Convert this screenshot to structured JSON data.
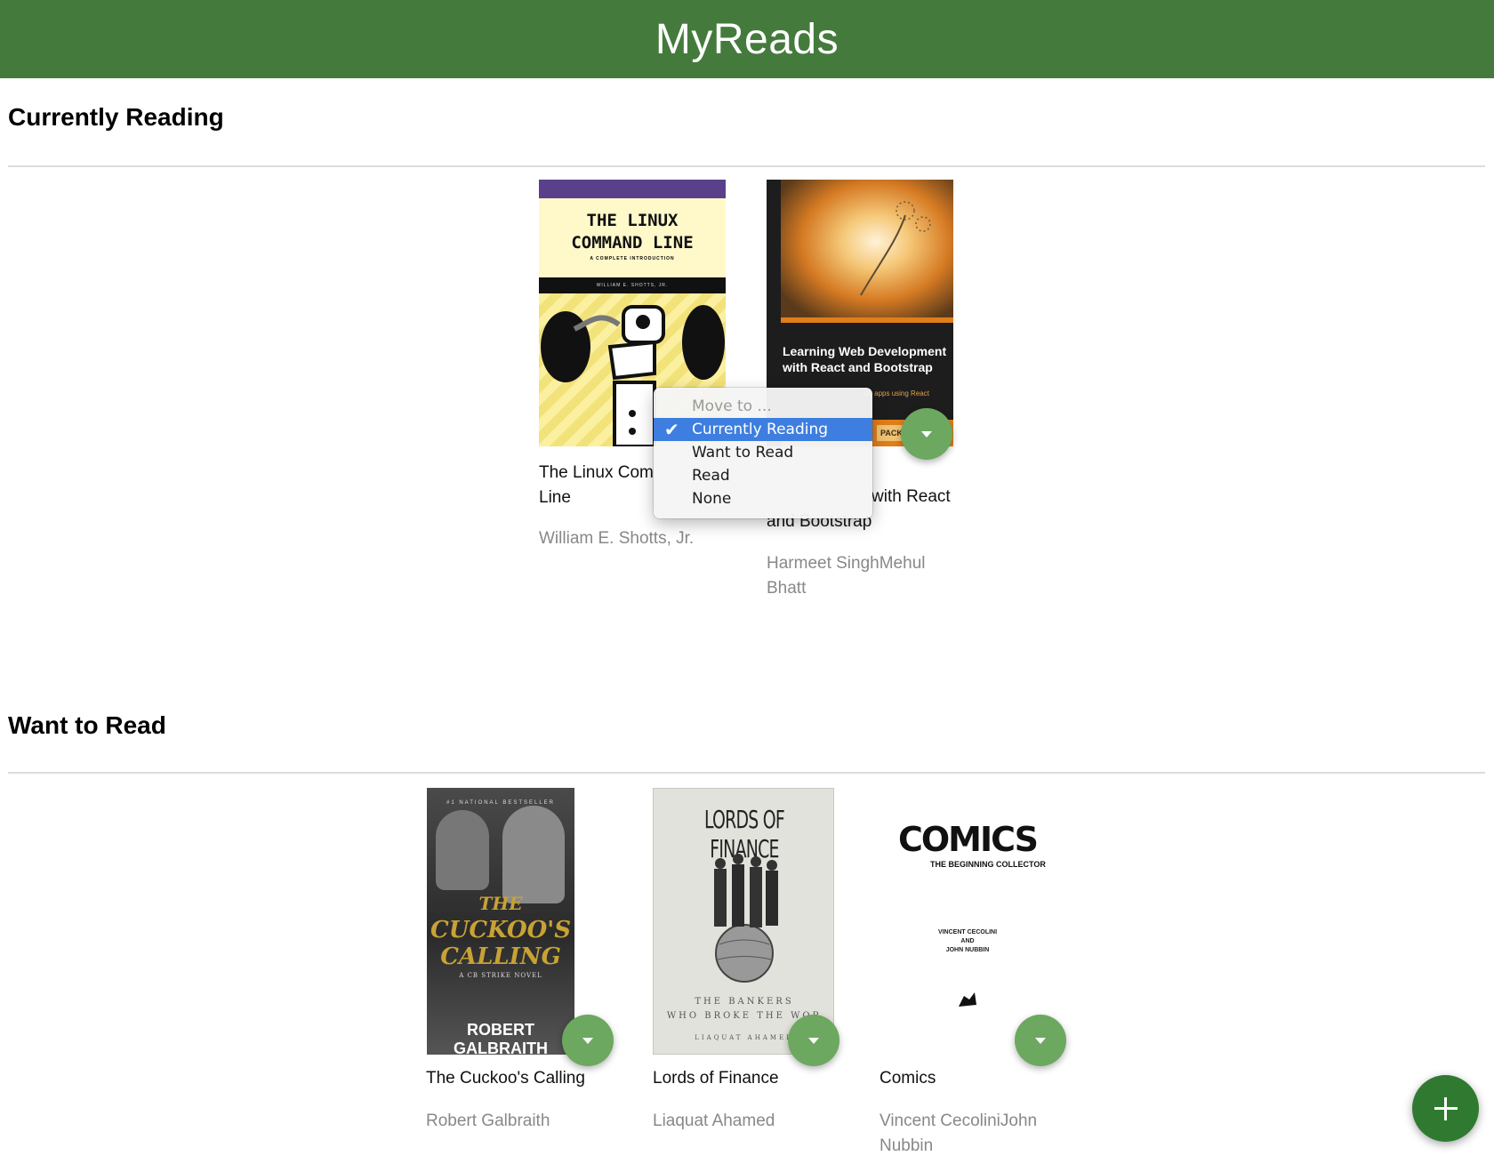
{
  "app": {
    "title": "MyReads"
  },
  "shelves": [
    {
      "title": "Currently Reading",
      "books": [
        {
          "title": "The Linux Command Line",
          "title_line1": "The Linux Com",
          "title_line2": "Line",
          "authors": "William E. Shotts, Jr.",
          "cover": {
            "heading_line1": "THE LINUX",
            "heading_line2": "COMMAND LINE",
            "subtitle": "A COMPLETE INTRODUCTION",
            "author": "WILLIAM E. SHOTTS, JR."
          }
        },
        {
          "title": "Learning Web Development with React and Bootstrap",
          "title_line2": "with React",
          "title_line3": "and Bootstrap",
          "authors_line1": "Harmeet SinghMehul",
          "authors_line2": "Bhatt",
          "cover": {
            "heading_line1": "Learning Web Development",
            "heading_line2": "with React and Bootstrap",
            "tagline": "ob apps using React",
            "publisher": "PACK"
          }
        }
      ]
    },
    {
      "title": "Want to Read",
      "books": [
        {
          "title": "The Cuckoo's Calling",
          "authors": "Robert Galbraith",
          "cover": {
            "badge": "#1 NATIONAL BESTSELLER",
            "heading_line1": "THE",
            "heading_line2": "CUCKOO'S",
            "heading_line3": "CALLING",
            "subtitle": "A CB STRIKE NOVEL",
            "author": "ROBERT GALBRAITH"
          }
        },
        {
          "title": "Lords of Finance",
          "authors": "Liaquat Ahamed",
          "cover": {
            "heading": "LORDS OF FINANCE",
            "sub_line1": "THE BANKERS",
            "sub_line2": "WHO BROKE THE WOR",
            "author": "LIAQUAT AHAMED"
          }
        },
        {
          "title": "Comics",
          "authors_line1": "Vincent CecoliniJohn",
          "authors_line2": "Nubbin",
          "cover": {
            "heading": "COMICS",
            "subtitle": "THE BEGINNING COLLECTOR",
            "author_line1": "VINCENT CECOLINI",
            "author_line2": "AND",
            "author_line3": "JOHN NUBBIN"
          }
        }
      ]
    }
  ],
  "move_menu": {
    "header": "Move to ...",
    "options": [
      "Currently Reading",
      "Want to Read",
      "Read",
      "None"
    ],
    "selected": "Currently Reading"
  },
  "colors": {
    "header_bg": "#447b3c",
    "changer_button": "#6ca85f",
    "add_button": "#2f7a30",
    "menu_highlight": "#3d7ee0"
  },
  "icons": {
    "changer": "caret-down-icon",
    "add": "plus-icon",
    "selected": "checkmark-icon"
  }
}
